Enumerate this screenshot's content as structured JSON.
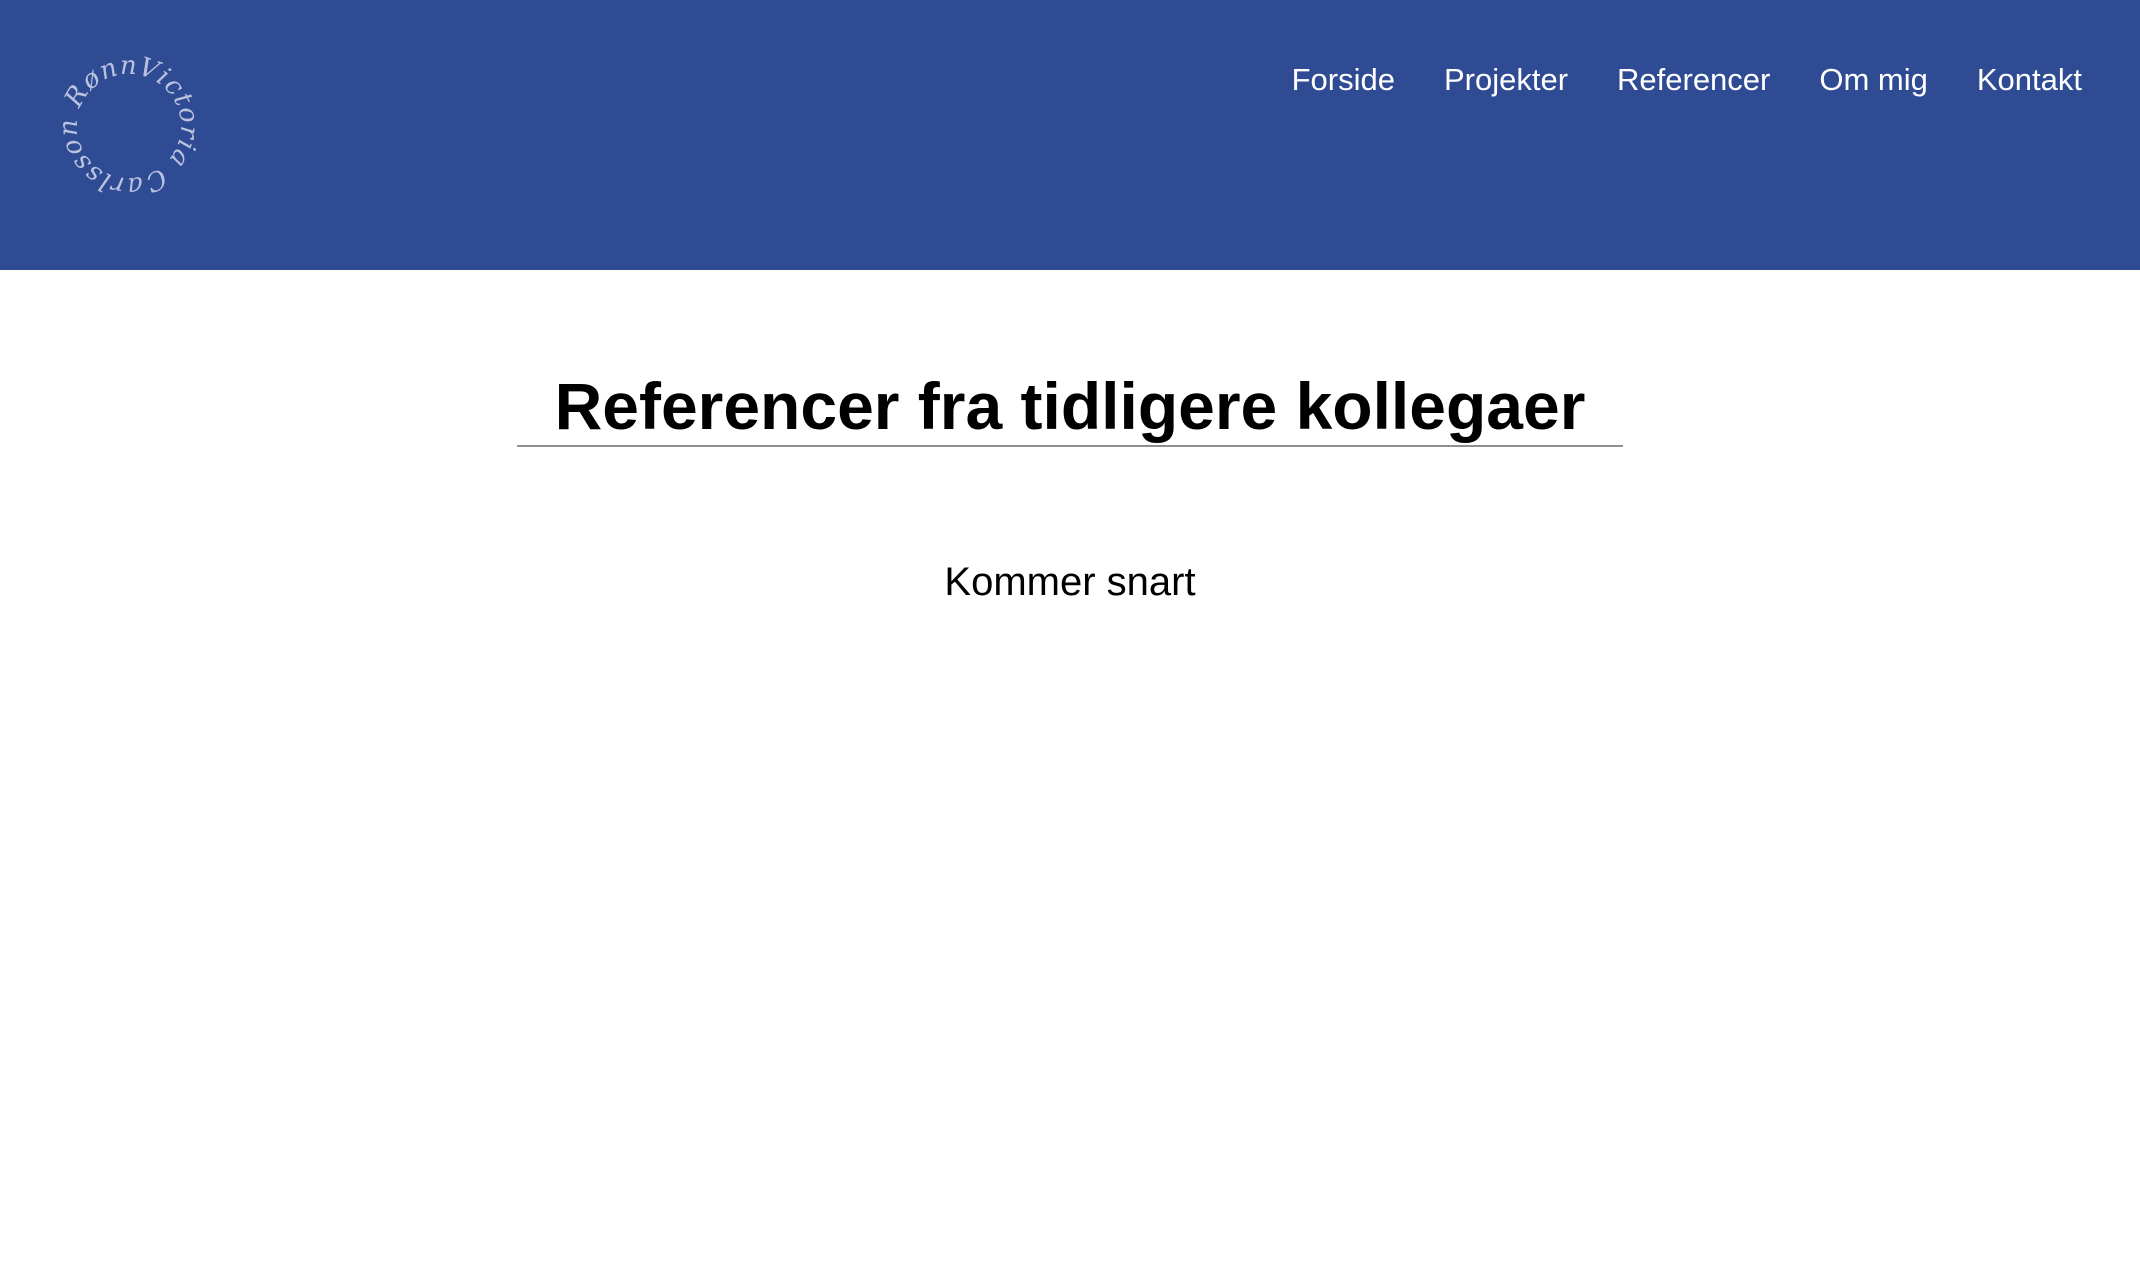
{
  "header": {
    "logo": {
      "text": "Victoria Carlsson Rønne",
      "icon": "circular-signature-logo"
    },
    "nav": {
      "items": [
        {
          "label": "Forside"
        },
        {
          "label": "Projekter"
        },
        {
          "label": "Referencer"
        },
        {
          "label": "Om mig"
        },
        {
          "label": "Kontakt"
        }
      ]
    }
  },
  "main": {
    "title": "Referencer fra tidligere kollegaer",
    "status": "Kommer snart"
  },
  "colors": {
    "header_background": "#2f4b93",
    "nav_text": "#ffffff",
    "title_text": "#000000",
    "rule": "#8f8f8f"
  }
}
